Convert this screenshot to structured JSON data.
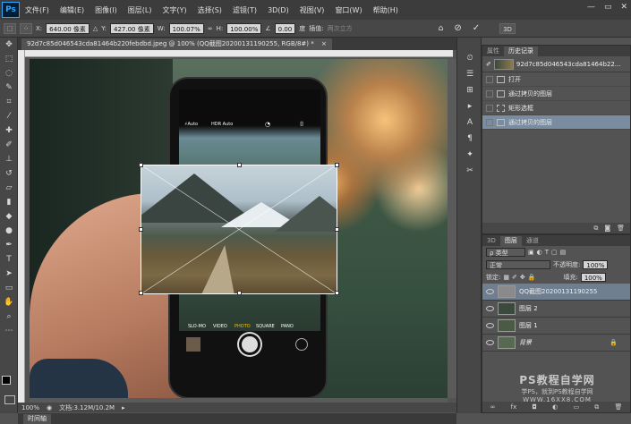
{
  "app": {
    "logo": "Ps"
  },
  "menu": [
    "文件(F)",
    "编辑(E)",
    "图像(I)",
    "图层(L)",
    "文字(Y)",
    "选择(S)",
    "滤镜(T)",
    "3D(D)",
    "视图(V)",
    "窗口(W)",
    "帮助(H)"
  ],
  "window_controls": {
    "minimize": "—",
    "restore": "▭",
    "close": "✕"
  },
  "options": {
    "x_label": "X:",
    "x_value": "640.00 像素",
    "y_label": "Y:",
    "y_value": "427.00 像素",
    "w_label": "W:",
    "w_value": "100.07%",
    "h_label": "H:",
    "h_value": "100.00%",
    "angle_value": "0.00",
    "angle_unit": "度",
    "interp": "插值:",
    "interp_value": "两次立方",
    "right_badge": "3D"
  },
  "document": {
    "tab": "92d7c85d046543cda81464b220febdbd.jpeg @ 100% (QQ截图20200131190255, RGB/8#) *",
    "close": "×"
  },
  "canvas": {
    "cam_flash": "⚡Auto",
    "cam_hdr": "HDR Auto",
    "modes": [
      "SLO-MO",
      "VIDEO",
      "PHOTO",
      "SQUARE",
      "PANO"
    ]
  },
  "status": {
    "zoom": "100%",
    "doc_size": "文档:3.12M/10.2M",
    "arrow": "▸"
  },
  "timeline_tab": "时间轴",
  "history": {
    "tabs": [
      "属性",
      "历史记录"
    ],
    "active_tab": 1,
    "snapshot_name": "92d7c85d046543cda81464b22...",
    "rows": [
      {
        "label": "打开",
        "selected": false
      },
      {
        "label": "通过拷贝的图层",
        "selected": false
      },
      {
        "label": "矩形选框",
        "selected": false
      },
      {
        "label": "通过拷贝的图层",
        "selected": true
      }
    ]
  },
  "layers": {
    "tabs": [
      "3D",
      "图层",
      "通道"
    ],
    "active_tab": 1,
    "filter_label": "ρ 类型",
    "blend_mode": "正常",
    "opacity_label": "不透明度:",
    "opacity_value": "100%",
    "lock_label": "锁定:",
    "fill_label": "填充:",
    "fill_value": "100%",
    "items": [
      {
        "name": "QQ截图20200131190255",
        "selected": true,
        "thumb": "#8a8a8a"
      },
      {
        "name": "图层 2",
        "selected": false,
        "thumb": "#3a4a3c"
      },
      {
        "name": "图层 1",
        "selected": false,
        "thumb": "#4a5a45"
      },
      {
        "name": "背景",
        "selected": false,
        "thumb": "#556a50",
        "locked": true
      }
    ]
  },
  "watermark": {
    "title": "PS教程自学网",
    "subtitle": "学PS，就到PS教程自学网",
    "url": "WWW.16XX8.COM"
  }
}
